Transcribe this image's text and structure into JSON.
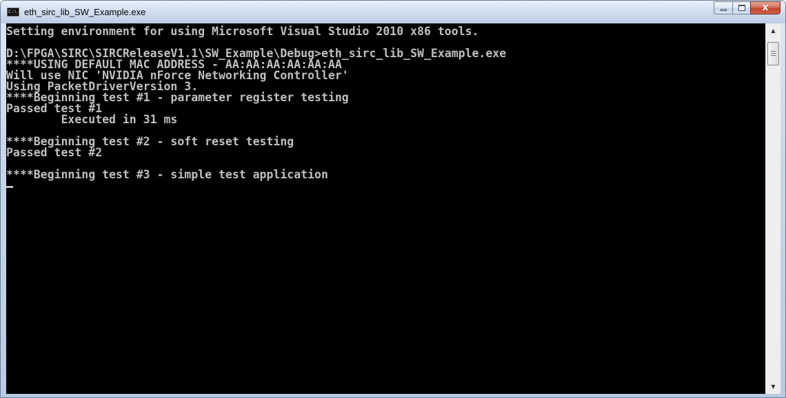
{
  "window": {
    "title": "eth_sirc_lib_SW_Example.exe",
    "app_icon_label": "C:\\"
  },
  "caption_buttons": {
    "minimize": "minimize",
    "maximize": "maximize",
    "close": "x"
  },
  "console": {
    "lines": [
      "Setting environment for using Microsoft Visual Studio 2010 x86 tools.",
      "",
      "D:\\FPGA\\SIRC\\SIRCReleaseV1.1\\SW_Example\\Debug>eth_sirc_lib_SW_Example.exe",
      "****USING DEFAULT MAC ADDRESS - AA:AA:AA:AA:AA:AA",
      "Will use NIC 'NVIDIA nForce Networking Controller'",
      "Using PacketDriverVersion 3.",
      "****Beginning test #1 - parameter register testing",
      "Passed test #1",
      "        Executed in 31 ms",
      "",
      "****Beginning test #2 - soft reset testing",
      "Passed test #2",
      "",
      "****Beginning test #3 - simple test application"
    ]
  },
  "scrollbar": {
    "up_icon": "scroll-up-arrow",
    "down_icon": "scroll-down-arrow"
  },
  "colors": {
    "console_bg": "#000000",
    "console_fg": "#c0c0c0",
    "close_button": "#c0432c"
  }
}
